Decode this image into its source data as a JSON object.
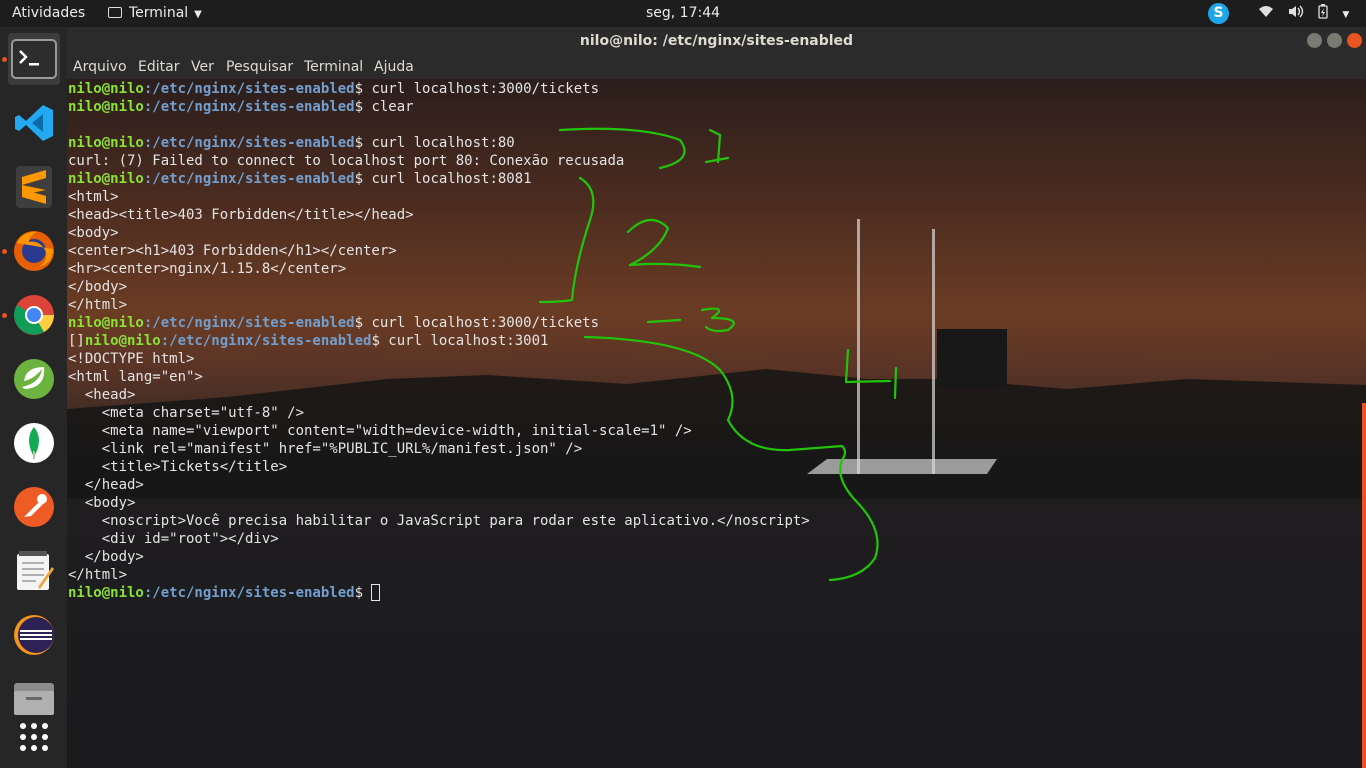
{
  "topbar": {
    "activities": "Atividades",
    "app_name": "Terminal",
    "clock": "seg, 17:44"
  },
  "dock": {
    "items": [
      {
        "name": "terminal",
        "color": "#2d2d2d"
      },
      {
        "name": "vscode",
        "color": "#23a9f2"
      },
      {
        "name": "sublime-text",
        "color": "#ff9800"
      },
      {
        "name": "firefox",
        "color": "#e66000"
      },
      {
        "name": "chrome",
        "color": "#4285f4"
      },
      {
        "name": "spring-tool-suite",
        "color": "#6db33f"
      },
      {
        "name": "mongodb-compass",
        "color": "#13aa52"
      },
      {
        "name": "postman",
        "color": "#ef5b25"
      },
      {
        "name": "text-editor",
        "color": "#f4f4f4"
      },
      {
        "name": "eclipse",
        "color": "#2c2255"
      },
      {
        "name": "files",
        "color": "#8c8c8c"
      },
      {
        "name": "show-applications",
        "color": "#ffffff"
      }
    ]
  },
  "window": {
    "title": "nilo@nilo: /etc/nginx/sites-enabled",
    "menu": [
      "Arquivo",
      "Editar",
      "Ver",
      "Pesquisar",
      "Terminal",
      "Ajuda"
    ]
  },
  "terminal": {
    "user": "nilo@nilo",
    "path": ":/etc/nginx/sites-enabled",
    "prompt_suffix": "$ ",
    "lines": [
      {
        "type": "cmd",
        "cmd": "curl localhost:3000/tickets"
      },
      {
        "type": "cmd",
        "cmd": "clear"
      },
      {
        "type": "out",
        "text": ""
      },
      {
        "type": "cmd",
        "cmd": "curl localhost:80"
      },
      {
        "type": "out",
        "text": "curl: (7) Failed to connect to localhost port 80: Conexão recusada"
      },
      {
        "type": "cmd",
        "cmd": "curl localhost:8081"
      },
      {
        "type": "out",
        "text": "<html>"
      },
      {
        "type": "out",
        "text": "<head><title>403 Forbidden</title></head>"
      },
      {
        "type": "out",
        "text": "<body>"
      },
      {
        "type": "out",
        "text": "<center><h1>403 Forbidden</h1></center>"
      },
      {
        "type": "out",
        "text": "<hr><center>nginx/1.15.8</center>"
      },
      {
        "type": "out",
        "text": "</body>"
      },
      {
        "type": "out",
        "text": "</html>"
      },
      {
        "type": "cmd",
        "cmd": "curl localhost:3000/tickets"
      },
      {
        "type": "cmd",
        "pre": "[]",
        "cmd": "curl localhost:3001"
      },
      {
        "type": "out",
        "text": "<!DOCTYPE html>"
      },
      {
        "type": "out",
        "text": "<html lang=\"en\">"
      },
      {
        "type": "out",
        "text": "  <head>"
      },
      {
        "type": "out",
        "text": "    <meta charset=\"utf-8\" />"
      },
      {
        "type": "out",
        "text": "    <meta name=\"viewport\" content=\"width=device-width, initial-scale=1\" />"
      },
      {
        "type": "out",
        "text": "    <link rel=\"manifest\" href=\"%PUBLIC_URL%/manifest.json\" />"
      },
      {
        "type": "out",
        "text": "    <title>Tickets</title>"
      },
      {
        "type": "out",
        "text": "  </head>"
      },
      {
        "type": "out",
        "text": "  <body>"
      },
      {
        "type": "out",
        "text": "    <noscript>Você precisa habilitar o JavaScript para rodar este aplicativo.</noscript>"
      },
      {
        "type": "out",
        "text": "    <div id=\"root\"></div>"
      },
      {
        "type": "out",
        "text": "  </body>"
      },
      {
        "type": "out",
        "text": "</html>"
      },
      {
        "type": "prompt"
      }
    ]
  },
  "annotations": {
    "color": "#22c40a",
    "labels": [
      "1",
      "2",
      "3",
      "4"
    ]
  }
}
